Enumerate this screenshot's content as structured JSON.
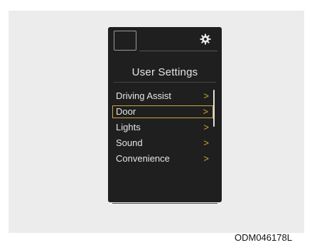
{
  "screen": {
    "title": "User Settings",
    "settings_icon": "gear-icon",
    "menu": [
      {
        "label": "Driving Assist",
        "chevron": ">",
        "selected": false
      },
      {
        "label": "Door",
        "chevron": ">",
        "selected": true
      },
      {
        "label": "Lights",
        "chevron": ">",
        "selected": false
      },
      {
        "label": "Sound",
        "chevron": ">",
        "selected": false
      },
      {
        "label": "Convenience",
        "chevron": ">",
        "selected": false
      }
    ]
  },
  "figure_code": "ODM046178L",
  "colors": {
    "accent": "#c8a93a",
    "screen_background": "#1f1f1f",
    "text": "#e6e6e6"
  }
}
